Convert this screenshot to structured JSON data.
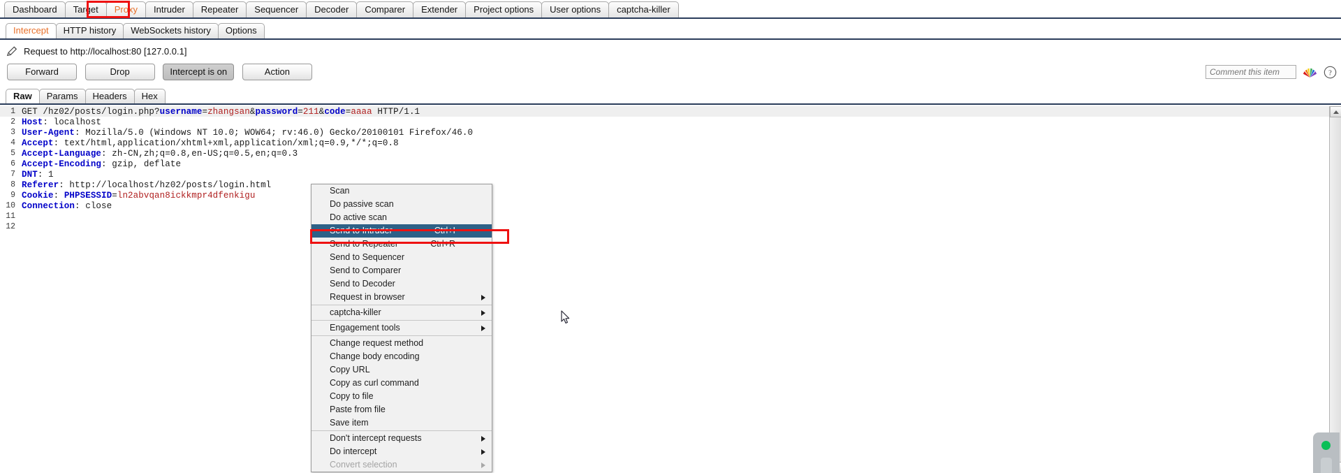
{
  "main_tabs": [
    {
      "label": "Dashboard",
      "active": false
    },
    {
      "label": "Target",
      "active": false
    },
    {
      "label": "Proxy",
      "active": true
    },
    {
      "label": "Intruder",
      "active": false
    },
    {
      "label": "Repeater",
      "active": false
    },
    {
      "label": "Sequencer",
      "active": false
    },
    {
      "label": "Decoder",
      "active": false
    },
    {
      "label": "Comparer",
      "active": false
    },
    {
      "label": "Extender",
      "active": false
    },
    {
      "label": "Project options",
      "active": false
    },
    {
      "label": "User options",
      "active": false
    },
    {
      "label": "captcha-killer",
      "active": false
    }
  ],
  "sub_tabs": [
    {
      "label": "Intercept",
      "active": true
    },
    {
      "label": "HTTP history",
      "active": false
    },
    {
      "label": "WebSockets history",
      "active": false
    },
    {
      "label": "Options",
      "active": false
    }
  ],
  "request_header": {
    "icon": "pencil-icon",
    "text": "Request to http://localhost:80  [127.0.0.1]"
  },
  "toolbar": {
    "forward_label": "Forward",
    "drop_label": "Drop",
    "intercept_label": "Intercept is on",
    "action_label": "Action",
    "comment_placeholder": "Comment this item",
    "comment_value": "",
    "fan_icon": "highlighter-fan-icon",
    "help_icon": "question-mark-icon"
  },
  "editor_tabs": [
    {
      "label": "Raw",
      "active": true
    },
    {
      "label": "Params",
      "active": false
    },
    {
      "label": "Headers",
      "active": false
    },
    {
      "label": "Hex",
      "active": false
    }
  ],
  "request_lines": [
    {
      "n": "1",
      "highlight": true,
      "parts": [
        {
          "t": "GET /hz02/posts/login.php?",
          "c": "plain"
        },
        {
          "t": "username",
          "c": "blue"
        },
        {
          "t": "=",
          "c": "plain"
        },
        {
          "t": "zhangsan",
          "c": "red"
        },
        {
          "t": "&",
          "c": "plain"
        },
        {
          "t": "password",
          "c": "blue"
        },
        {
          "t": "=",
          "c": "plain"
        },
        {
          "t": "211",
          "c": "red"
        },
        {
          "t": "&",
          "c": "plain"
        },
        {
          "t": "code",
          "c": "blue"
        },
        {
          "t": "=",
          "c": "plain"
        },
        {
          "t": "aaaa",
          "c": "red"
        },
        {
          "t": " HTTP/1.1",
          "c": "plain"
        }
      ]
    },
    {
      "n": "2",
      "highlight": false,
      "parts": [
        {
          "t": "Host",
          "c": "blue"
        },
        {
          "t": ": localhost",
          "c": "plain"
        }
      ]
    },
    {
      "n": "3",
      "highlight": false,
      "parts": [
        {
          "t": "User-Agent",
          "c": "blue"
        },
        {
          "t": ": Mozilla/5.0 (Windows NT 10.0; WOW64; rv:46.0) Gecko/20100101 Firefox/46.0",
          "c": "plain"
        }
      ]
    },
    {
      "n": "4",
      "highlight": false,
      "parts": [
        {
          "t": "Accept",
          "c": "blue"
        },
        {
          "t": ": text/html,application/xhtml+xml,application/xml;q=0.9,*/*;q=0.8",
          "c": "plain"
        }
      ]
    },
    {
      "n": "5",
      "highlight": false,
      "parts": [
        {
          "t": "Accept-Language",
          "c": "blue"
        },
        {
          "t": ": zh-CN,zh;q=0.8,en-US;q=0.5,en;q=0.3",
          "c": "plain"
        }
      ]
    },
    {
      "n": "6",
      "highlight": false,
      "parts": [
        {
          "t": "Accept-Encoding",
          "c": "blue"
        },
        {
          "t": ": gzip, deflate",
          "c": "plain"
        }
      ]
    },
    {
      "n": "7",
      "highlight": false,
      "parts": [
        {
          "t": "DNT",
          "c": "blue"
        },
        {
          "t": ": 1",
          "c": "plain"
        }
      ]
    },
    {
      "n": "8",
      "highlight": false,
      "parts": [
        {
          "t": "Referer",
          "c": "blue"
        },
        {
          "t": ": http://localhost/hz02/posts/login.html",
          "c": "plain"
        }
      ]
    },
    {
      "n": "9",
      "highlight": false,
      "parts": [
        {
          "t": "Cookie",
          "c": "blue"
        },
        {
          "t": ": ",
          "c": "plain"
        },
        {
          "t": "PHPSESSID",
          "c": "blue"
        },
        {
          "t": "=",
          "c": "plain"
        },
        {
          "t": "ln2abvqan8ickkmpr4dfenkigu",
          "c": "red"
        }
      ]
    },
    {
      "n": "10",
      "highlight": false,
      "parts": [
        {
          "t": "Connection",
          "c": "blue"
        },
        {
          "t": ": close",
          "c": "plain"
        }
      ]
    },
    {
      "n": "11",
      "highlight": false,
      "parts": [
        {
          "t": "",
          "c": "plain"
        }
      ]
    },
    {
      "n": "12",
      "highlight": false,
      "parts": [
        {
          "t": "",
          "c": "plain"
        }
      ]
    }
  ],
  "context_menu": [
    {
      "label": "Scan",
      "accel": "",
      "submenu": false,
      "selected": false,
      "disabled": false,
      "separator_after": false
    },
    {
      "label": "Do passive scan",
      "accel": "",
      "submenu": false,
      "selected": false,
      "disabled": false,
      "separator_after": false
    },
    {
      "label": "Do active scan",
      "accel": "",
      "submenu": false,
      "selected": false,
      "disabled": false,
      "separator_after": false
    },
    {
      "label": "Send to Intruder",
      "accel": "Ctrl+I",
      "submenu": false,
      "selected": true,
      "disabled": false,
      "separator_after": false
    },
    {
      "label": "Send to Repeater",
      "accel": "Ctrl+R",
      "submenu": false,
      "selected": false,
      "disabled": false,
      "separator_after": false
    },
    {
      "label": "Send to Sequencer",
      "accel": "",
      "submenu": false,
      "selected": false,
      "disabled": false,
      "separator_after": false
    },
    {
      "label": "Send to Comparer",
      "accel": "",
      "submenu": false,
      "selected": false,
      "disabled": false,
      "separator_after": false
    },
    {
      "label": "Send to Decoder",
      "accel": "",
      "submenu": false,
      "selected": false,
      "disabled": false,
      "separator_after": false
    },
    {
      "label": "Request in browser",
      "accel": "",
      "submenu": true,
      "selected": false,
      "disabled": false,
      "separator_after": true
    },
    {
      "label": "captcha-killer",
      "accel": "",
      "submenu": true,
      "selected": false,
      "disabled": false,
      "separator_after": true
    },
    {
      "label": "Engagement tools",
      "accel": "",
      "submenu": true,
      "selected": false,
      "disabled": false,
      "separator_after": true
    },
    {
      "label": "Change request method",
      "accel": "",
      "submenu": false,
      "selected": false,
      "disabled": false,
      "separator_after": false
    },
    {
      "label": "Change body encoding",
      "accel": "",
      "submenu": false,
      "selected": false,
      "disabled": false,
      "separator_after": false
    },
    {
      "label": "Copy URL",
      "accel": "",
      "submenu": false,
      "selected": false,
      "disabled": false,
      "separator_after": false
    },
    {
      "label": "Copy as curl command",
      "accel": "",
      "submenu": false,
      "selected": false,
      "disabled": false,
      "separator_after": false
    },
    {
      "label": "Copy to file",
      "accel": "",
      "submenu": false,
      "selected": false,
      "disabled": false,
      "separator_after": false
    },
    {
      "label": "Paste from file",
      "accel": "",
      "submenu": false,
      "selected": false,
      "disabled": false,
      "separator_after": false
    },
    {
      "label": "Save item",
      "accel": "",
      "submenu": false,
      "selected": false,
      "disabled": false,
      "separator_after": true
    },
    {
      "label": "Don't intercept requests",
      "accel": "",
      "submenu": true,
      "selected": false,
      "disabled": false,
      "separator_after": false
    },
    {
      "label": "Do intercept",
      "accel": "",
      "submenu": true,
      "selected": false,
      "disabled": false,
      "separator_after": false
    },
    {
      "label": "Convert selection",
      "accel": "",
      "submenu": true,
      "selected": false,
      "disabled": true,
      "separator_after": false
    }
  ],
  "annotations": {
    "proxy_tab_highlight_color": "#ee1111",
    "intruder_item_highlight_color": "#ee1111"
  },
  "status_widget": {
    "indicator_color": "#0bbf57",
    "name": "status-indicator"
  }
}
